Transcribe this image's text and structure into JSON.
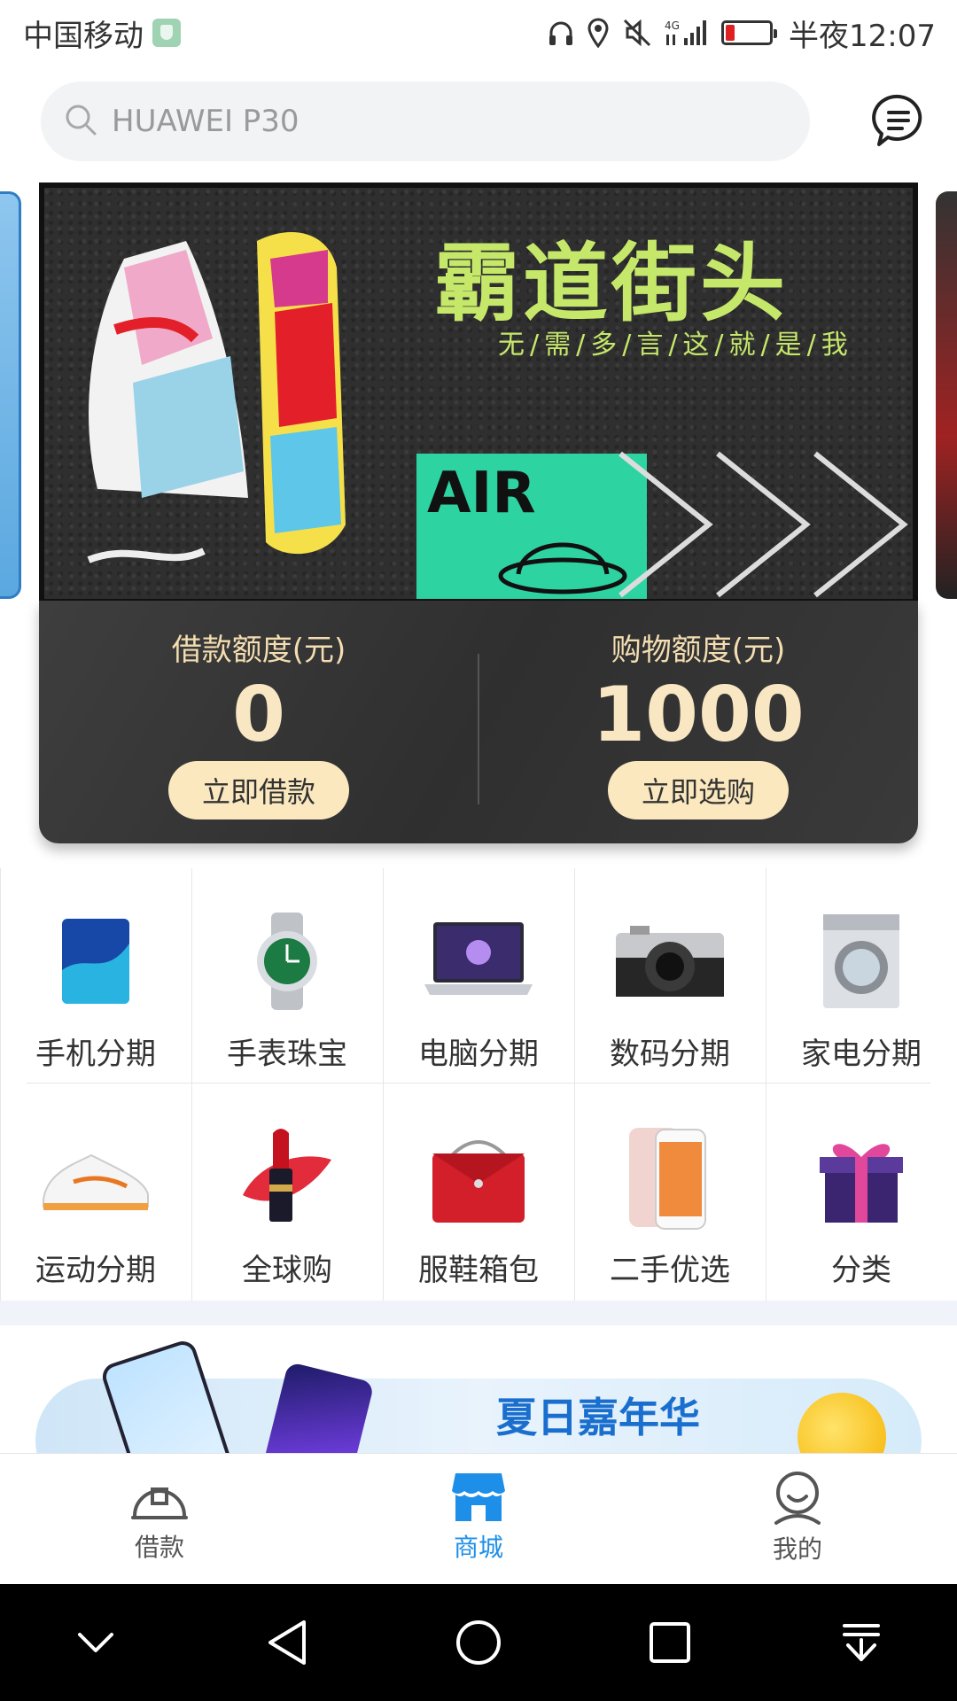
{
  "status_bar": {
    "carrier": "中国移动",
    "network": "4G",
    "time": "半夜12:07"
  },
  "search": {
    "placeholder": "HUAWEI P30"
  },
  "banner": {
    "title": "霸道街头",
    "subtitle": "无/需/多/言/这/就/是/我",
    "tag": "AIR"
  },
  "credit": {
    "loan": {
      "label": "借款额度(元)",
      "value": "0",
      "button": "立即借款"
    },
    "shopping": {
      "label": "购物额度(元)",
      "value": "1000",
      "button": "立即选购"
    }
  },
  "categories": [
    {
      "label": "手机分期",
      "icon": "phone-icon"
    },
    {
      "label": "手表珠宝",
      "icon": "watch-icon"
    },
    {
      "label": "电脑分期",
      "icon": "laptop-icon"
    },
    {
      "label": "数码分期",
      "icon": "camera-icon"
    },
    {
      "label": "家电分期",
      "icon": "washing-machine-icon"
    },
    {
      "label": "运动分期",
      "icon": "sneaker-icon"
    },
    {
      "label": "全球购",
      "icon": "lipstick-icon"
    },
    {
      "label": "服鞋箱包",
      "icon": "handbag-icon"
    },
    {
      "label": "二手优选",
      "icon": "iphone-icon"
    },
    {
      "label": "分类",
      "icon": "gift-icon"
    }
  ],
  "promo": {
    "text": "夏日嘉年华"
  },
  "bottom_nav": {
    "items": [
      {
        "label": "借款",
        "icon": "loan-icon"
      },
      {
        "label": "商城",
        "icon": "store-icon",
        "active": true
      },
      {
        "label": "我的",
        "icon": "profile-icon"
      }
    ]
  },
  "colors": {
    "accent": "#1e8fe8",
    "card_gold": "#fbe8bf",
    "banner_green": "#c6e86a"
  }
}
